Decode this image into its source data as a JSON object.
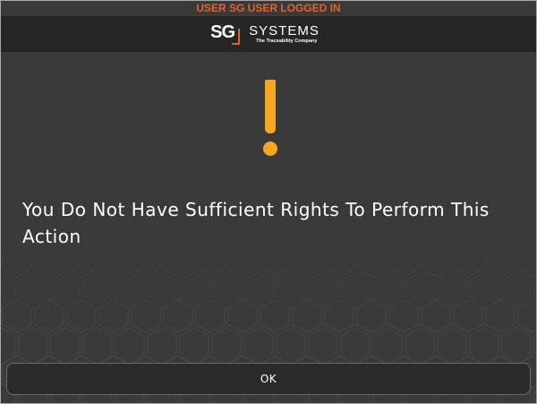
{
  "status_bar": {
    "logged_in_text": "USER SG USER LOGGED IN"
  },
  "logo": {
    "mark": "SG",
    "title": "SYSTEMS",
    "tagline": "The Traceability Company"
  },
  "alert": {
    "icon": "exclamation-icon",
    "message": "You Do Not Have Sufficient Rights To Perform This Action"
  },
  "actions": {
    "ok_label": "OK"
  },
  "colors": {
    "background": "#3a3a3a",
    "header": "#262626",
    "accent_orange": "#e5622b",
    "alert_yellow": "#f5a623",
    "text": "#ffffff"
  }
}
